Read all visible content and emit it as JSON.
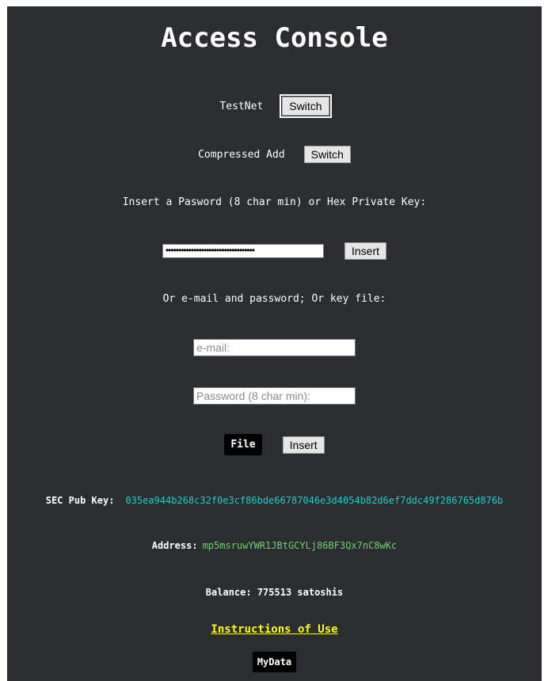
{
  "title": "Access Console",
  "testnet": {
    "label": "TestNet",
    "button": "Switch"
  },
  "compressed": {
    "label": "Compressed Add",
    "button": "Switch"
  },
  "private_key": {
    "prompt": "Insert a Pasword (8 char min) or Hex Private Key:",
    "masked_value": "•••••••••••••••••••••••••••••••••••",
    "insert_button": "Insert"
  },
  "alt_login": {
    "prompt": "Or e-mail and password; Or key file:",
    "email_placeholder": "e-mail:",
    "password_placeholder": "Password (8 char min):",
    "file_button": "File",
    "insert_button": "Insert"
  },
  "wallet": {
    "pubkey_label": "SEC Pub Key:",
    "pubkey_value": "035ea944b268c32f0e3cf86bde66787046e3d4054b82d6ef7ddc49f286765d876b",
    "address_label": "Address:",
    "address_value": "mp5msruwYWR1JBtGCYLj86BF3Qx7nC8wKc",
    "balance_text": "Balance: 775513 satoshis"
  },
  "links": {
    "instructions": "Instructions of Use",
    "mydata": "MyData"
  },
  "colors": {
    "panel_bg": "#2b2d31",
    "pubkey": "#19d0d0",
    "address": "#6cd36c",
    "link": "#ffff00"
  }
}
